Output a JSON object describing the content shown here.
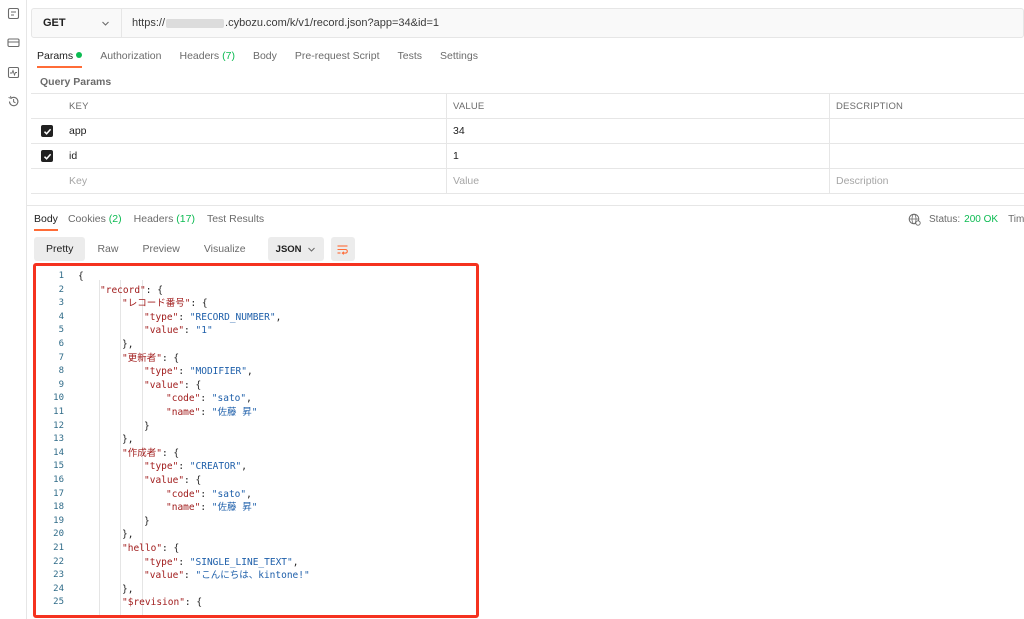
{
  "sidebar": {
    "icons": [
      "api-icon",
      "environment-icon",
      "monitor-icon",
      "history-icon"
    ]
  },
  "request": {
    "method": "GET",
    "url_prefix": "https://",
    "url_suffix": ".cybozu.com/k/v1/record.json?app=34&id=1"
  },
  "request_tabs": [
    {
      "label": "Params",
      "active": true,
      "dot": true
    },
    {
      "label": "Authorization"
    },
    {
      "label": "Headers",
      "count": "(7)"
    },
    {
      "label": "Body"
    },
    {
      "label": "Pre-request Script"
    },
    {
      "label": "Tests"
    },
    {
      "label": "Settings"
    }
  ],
  "query_params": {
    "title": "Query Params",
    "headers": {
      "key": "KEY",
      "value": "VALUE",
      "description": "DESCRIPTION"
    },
    "rows": [
      {
        "checked": true,
        "key": "app",
        "value": "34"
      },
      {
        "checked": true,
        "key": "id",
        "value": "1"
      }
    ],
    "placeholder": {
      "key": "Key",
      "value": "Value",
      "description": "Description"
    }
  },
  "response_tabs": [
    {
      "label": "Body",
      "active": true
    },
    {
      "label": "Cookies",
      "count": "(2)"
    },
    {
      "label": "Headers",
      "count": "(17)"
    },
    {
      "label": "Test Results"
    }
  ],
  "status": {
    "label": "Status:",
    "value": "200 OK",
    "time_label": "Time:"
  },
  "view_modes": [
    "Pretty",
    "Raw",
    "Preview",
    "Visualize"
  ],
  "format": "JSON",
  "code_lines": [
    {
      "n": "1",
      "indent": 0,
      "parts": [
        [
          "p",
          "{"
        ]
      ]
    },
    {
      "n": "2",
      "indent": 1,
      "parts": [
        [
          "k",
          "\"record\""
        ],
        [
          "p",
          ": {"
        ]
      ]
    },
    {
      "n": "3",
      "indent": 2,
      "parts": [
        [
          "k",
          "\"レコード番号\""
        ],
        [
          "p",
          ": {"
        ]
      ]
    },
    {
      "n": "4",
      "indent": 3,
      "parts": [
        [
          "k",
          "\"type\""
        ],
        [
          "p",
          ": "
        ],
        [
          "s",
          "\"RECORD_NUMBER\""
        ],
        [
          "p",
          ","
        ]
      ]
    },
    {
      "n": "5",
      "indent": 3,
      "parts": [
        [
          "k",
          "\"value\""
        ],
        [
          "p",
          ": "
        ],
        [
          "s",
          "\"1\""
        ]
      ]
    },
    {
      "n": "6",
      "indent": 2,
      "parts": [
        [
          "p",
          "},"
        ]
      ]
    },
    {
      "n": "7",
      "indent": 2,
      "parts": [
        [
          "k",
          "\"更新者\""
        ],
        [
          "p",
          ": {"
        ]
      ]
    },
    {
      "n": "8",
      "indent": 3,
      "parts": [
        [
          "k",
          "\"type\""
        ],
        [
          "p",
          ": "
        ],
        [
          "s",
          "\"MODIFIER\""
        ],
        [
          "p",
          ","
        ]
      ]
    },
    {
      "n": "9",
      "indent": 3,
      "parts": [
        [
          "k",
          "\"value\""
        ],
        [
          "p",
          ": {"
        ]
      ]
    },
    {
      "n": "10",
      "indent": 4,
      "parts": [
        [
          "k",
          "\"code\""
        ],
        [
          "p",
          ": "
        ],
        [
          "s",
          "\"sato\""
        ],
        [
          "p",
          ","
        ]
      ]
    },
    {
      "n": "11",
      "indent": 4,
      "parts": [
        [
          "k",
          "\"name\""
        ],
        [
          "p",
          ": "
        ],
        [
          "s",
          "\"佐藤 昇\""
        ]
      ]
    },
    {
      "n": "12",
      "indent": 3,
      "parts": [
        [
          "p",
          "}"
        ]
      ]
    },
    {
      "n": "13",
      "indent": 2,
      "parts": [
        [
          "p",
          "},"
        ]
      ]
    },
    {
      "n": "14",
      "indent": 2,
      "parts": [
        [
          "k",
          "\"作成者\""
        ],
        [
          "p",
          ": {"
        ]
      ]
    },
    {
      "n": "15",
      "indent": 3,
      "parts": [
        [
          "k",
          "\"type\""
        ],
        [
          "p",
          ": "
        ],
        [
          "s",
          "\"CREATOR\""
        ],
        [
          "p",
          ","
        ]
      ]
    },
    {
      "n": "16",
      "indent": 3,
      "parts": [
        [
          "k",
          "\"value\""
        ],
        [
          "p",
          ": {"
        ]
      ]
    },
    {
      "n": "17",
      "indent": 4,
      "parts": [
        [
          "k",
          "\"code\""
        ],
        [
          "p",
          ": "
        ],
        [
          "s",
          "\"sato\""
        ],
        [
          "p",
          ","
        ]
      ]
    },
    {
      "n": "18",
      "indent": 4,
      "parts": [
        [
          "k",
          "\"name\""
        ],
        [
          "p",
          ": "
        ],
        [
          "s",
          "\"佐藤 昇\""
        ]
      ]
    },
    {
      "n": "19",
      "indent": 3,
      "parts": [
        [
          "p",
          "}"
        ]
      ]
    },
    {
      "n": "20",
      "indent": 2,
      "parts": [
        [
          "p",
          "},"
        ]
      ]
    },
    {
      "n": "21",
      "indent": 2,
      "parts": [
        [
          "k",
          "\"hello\""
        ],
        [
          "p",
          ": {"
        ]
      ]
    },
    {
      "n": "22",
      "indent": 3,
      "parts": [
        [
          "k",
          "\"type\""
        ],
        [
          "p",
          ": "
        ],
        [
          "s",
          "\"SINGLE_LINE_TEXT\""
        ],
        [
          "p",
          ","
        ]
      ]
    },
    {
      "n": "23",
      "indent": 3,
      "parts": [
        [
          "k",
          "\"value\""
        ],
        [
          "p",
          ": "
        ],
        [
          "s",
          "\"こんにちは、kintone!\""
        ]
      ]
    },
    {
      "n": "24",
      "indent": 2,
      "parts": [
        [
          "p",
          "},"
        ]
      ]
    },
    {
      "n": "25",
      "indent": 2,
      "parts": [
        [
          "k",
          "\"$revision\""
        ],
        [
          "p",
          ": {"
        ]
      ]
    }
  ],
  "colors": {
    "accent": "#ff6c37",
    "success": "#0cbb52",
    "highlight_border": "#f5321f"
  }
}
